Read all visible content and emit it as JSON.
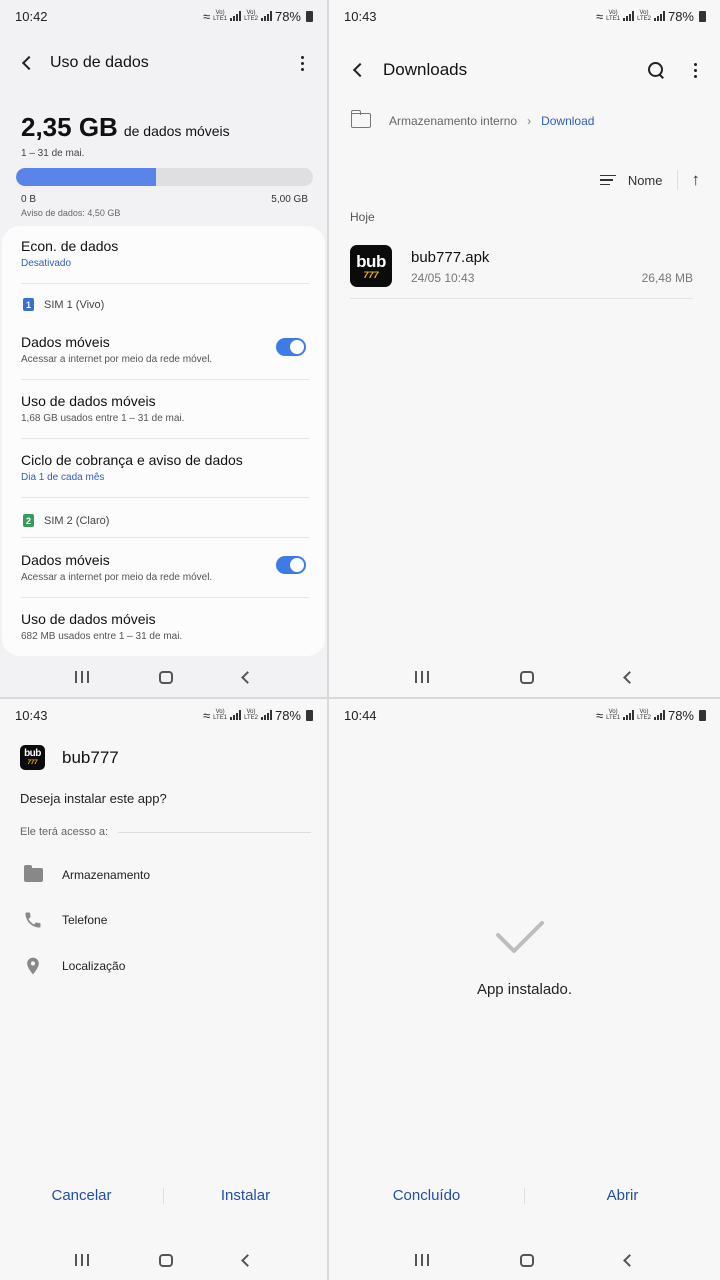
{
  "panel1": {
    "status": {
      "time": "10:42",
      "battery": "78%"
    },
    "title": "Uso de dados",
    "usage_value": "2,35 GB",
    "usage_unit": "de dados móveis",
    "period": "1 – 31 de mai.",
    "usage_fraction": 0.47,
    "scale_min": "0 B",
    "scale_max": "5,00 GB",
    "warning": "Aviso de dados: 4,50 GB",
    "saver": {
      "title": "Econ. de dados",
      "status": "Desativado"
    },
    "sim1": {
      "badge": "1",
      "label": "SIM 1 (Vivo)",
      "color": "#3a6fd1",
      "mobile_data": {
        "title": "Dados móveis",
        "subtitle": "Acessar a internet por meio da rede móvel.",
        "enabled": true
      },
      "usage": {
        "title": "Uso de dados móveis",
        "subtitle": "1,68 GB usados entre 1 – 31 de mai."
      },
      "billing": {
        "title": "Ciclo de cobrança e aviso de dados",
        "subtitle": "Dia 1 de cada mês"
      }
    },
    "sim2": {
      "badge": "2",
      "label": "SIM 2 (Claro)",
      "color": "#3a9a5b",
      "mobile_data": {
        "title": "Dados móveis",
        "subtitle": "Acessar a internet por meio da rede móvel.",
        "enabled": true
      },
      "usage": {
        "title": "Uso de dados móveis",
        "subtitle": "682 MB usados entre 1 – 31 de mai."
      }
    }
  },
  "panel2": {
    "status": {
      "time": "10:43",
      "battery": "78%"
    },
    "title": "Downloads",
    "breadcrumb": [
      "Armazenamento interno",
      "Download"
    ],
    "sort_label": "Nome",
    "section": "Hoje",
    "file": {
      "name": "bub777.apk",
      "date": "24/05 10:43",
      "size": "26,48 MB"
    }
  },
  "panel3": {
    "status": {
      "time": "10:43",
      "battery": "78%"
    },
    "app_name": "bub777",
    "question": "Deseja instalar este app?",
    "perm_header": "Ele terá acesso a:",
    "permissions": [
      {
        "label": "Armazenamento",
        "icon": "folder-icon"
      },
      {
        "label": "Telefone",
        "icon": "phone-icon"
      },
      {
        "label": "Localização",
        "icon": "location-pin-icon"
      }
    ],
    "cancel": "Cancelar",
    "install": "Instalar"
  },
  "panel4": {
    "status": {
      "time": "10:44",
      "battery": "78%"
    },
    "message": "App instalado.",
    "done": "Concluído",
    "open": "Abrir"
  },
  "logo": {
    "top": "bub",
    "bottom": "777"
  },
  "colors": {
    "accent_blue": "#2f5fb8",
    "toggle_on": "#3e7be6",
    "usage_fill": "#5a84e8",
    "logo_gold": "#f5b800"
  }
}
